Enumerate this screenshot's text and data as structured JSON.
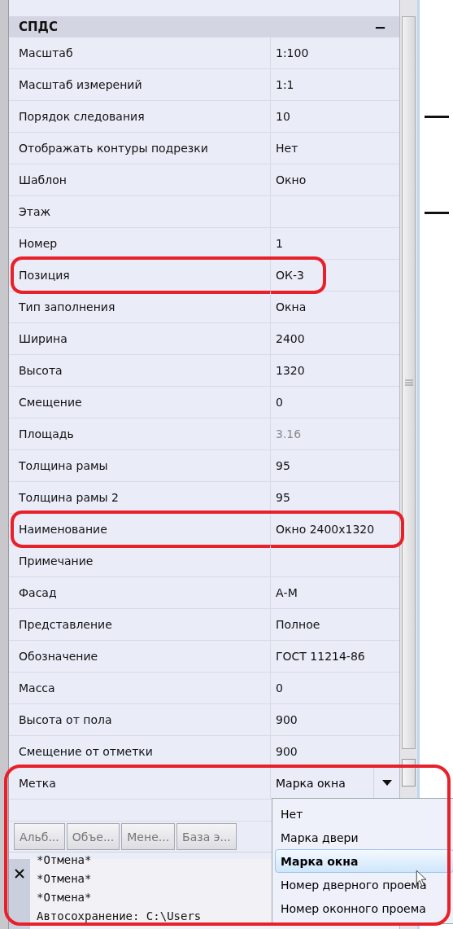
{
  "panel": {
    "title": "СПДС",
    "collapse": "−"
  },
  "properties": [
    {
      "label": "Масштаб",
      "value": "1:100",
      "disabled": false,
      "highlighted": false
    },
    {
      "label": "Масштаб измерений",
      "value": "1:1",
      "disabled": false,
      "highlighted": false
    },
    {
      "label": "Порядок следования",
      "value": "10",
      "disabled": false,
      "highlighted": false
    },
    {
      "label": "Отображать контуры подрезки",
      "value": "Нет",
      "disabled": false,
      "highlighted": false
    },
    {
      "label": "Шаблон",
      "value": "Окно",
      "disabled": false,
      "highlighted": false
    },
    {
      "label": "Этаж",
      "highlighted": false
    },
    {
      "label": "Номер",
      "value": "1",
      "disabled": false,
      "highlighted": false
    },
    {
      "label": "Позиция",
      "value": "ОК-3",
      "disabled": false,
      "highlighted": true
    },
    {
      "label": "Тип заполнения",
      "value": "Окна",
      "disabled": false,
      "highlighted": false
    },
    {
      "label": "Ширина",
      "value": "2400",
      "disabled": false,
      "highlighted": false
    },
    {
      "label": "Высота",
      "value": "1320",
      "disabled": false,
      "highlighted": false
    },
    {
      "label": "Смещение",
      "value": "0",
      "disabled": false,
      "highlighted": false
    },
    {
      "label": "Площадь",
      "value": "3.16",
      "disabled": true,
      "highlighted": false
    },
    {
      "label": "Толщина рамы",
      "value": "95",
      "disabled": false,
      "highlighted": false
    },
    {
      "label": "Толщина рамы 2",
      "value": "95",
      "disabled": false,
      "highlighted": false
    },
    {
      "label": "Наименование",
      "value": "Окно 2400x1320",
      "disabled": false,
      "highlighted": true
    },
    {
      "label": "Примечание",
      "highlighted": false
    },
    {
      "label": "Фасад",
      "value": "А-М",
      "disabled": false,
      "highlighted": false
    },
    {
      "label": "Представление",
      "value": "Полное",
      "disabled": false,
      "highlighted": false
    },
    {
      "label": "Обозначение",
      "value": "ГОСТ 11214-86",
      "disabled": false,
      "highlighted": false
    },
    {
      "label": "Масса",
      "value": "0",
      "disabled": false,
      "highlighted": false
    },
    {
      "label": "Высота от пола",
      "value": "900",
      "disabled": false,
      "highlighted": false
    },
    {
      "label": "Смещение от отметки",
      "value": "900",
      "disabled": false,
      "highlighted": false
    }
  ],
  "dropdown_property": {
    "label": "Метка",
    "value": "Марка окна",
    "expanded": true,
    "highlighted": true,
    "options": [
      {
        "label": "Нет",
        "selected": false
      },
      {
        "label": "Марка двери",
        "selected": false
      },
      {
        "label": "Марка окна",
        "selected": true
      },
      {
        "label": "Номер дверного проема",
        "selected": false
      },
      {
        "label": "Номер оконного проема",
        "selected": false
      }
    ]
  },
  "tabs": [
    {
      "label": "Альб..."
    },
    {
      "label": "Объе..."
    },
    {
      "label": "Мене..."
    },
    {
      "label": "База э..."
    }
  ],
  "command_history": [
    "*Отмена*",
    "*Отмена*",
    "*Отмена*",
    "Автосохранение: C:\\Users"
  ]
}
